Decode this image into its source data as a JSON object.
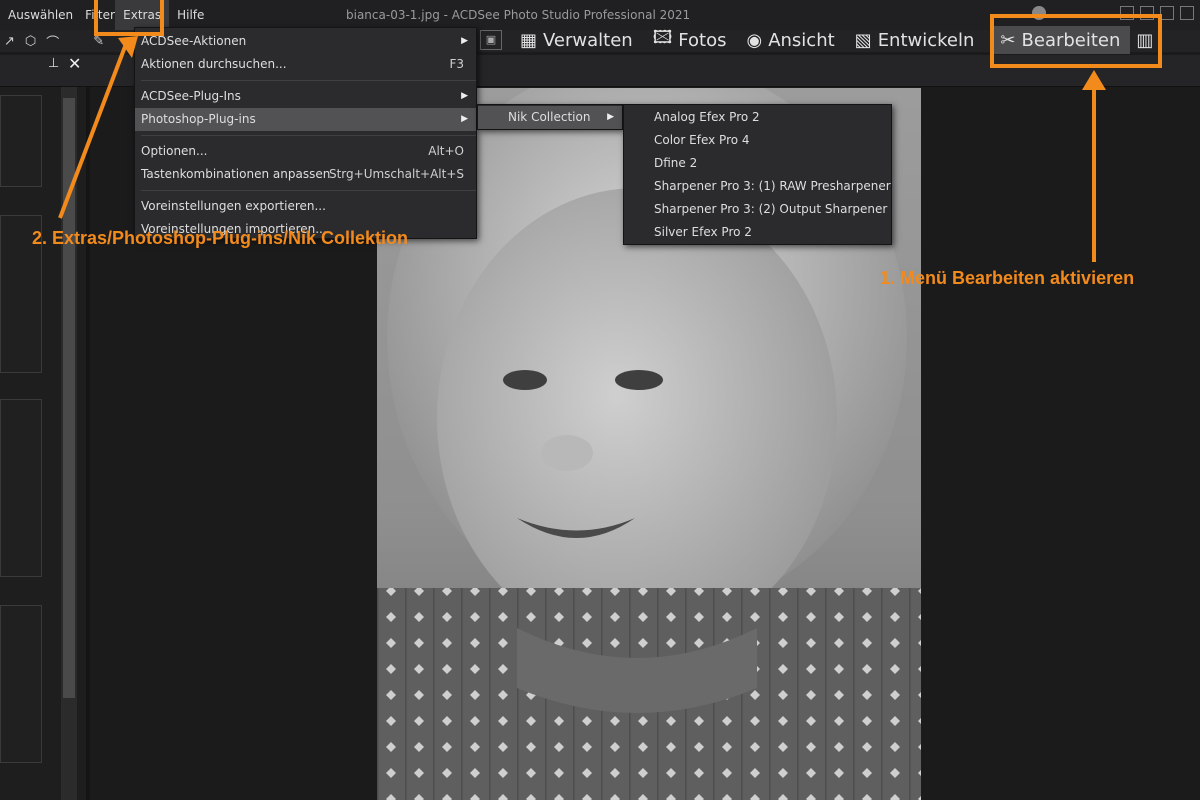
{
  "window": {
    "title": "bianca-03-1.jpg - ACDSee Photo Studio Professional 2021"
  },
  "menubar": [
    {
      "label": "Auswählen"
    },
    {
      "label": "Filter"
    },
    {
      "label": "Extras"
    },
    {
      "label": "Hilfe"
    }
  ],
  "modes": [
    {
      "label": "Verwalten",
      "icon": "grid-icon"
    },
    {
      "label": "Fotos",
      "icon": "photos-icon"
    },
    {
      "label": "Ansicht",
      "icon": "eye-icon"
    },
    {
      "label": "Entwickeln",
      "icon": "develop-icon"
    },
    {
      "label": "Bearbeiten",
      "icon": "edit-tools-icon"
    }
  ],
  "extras_menu": [
    {
      "label": "ACDSee-Aktionen",
      "shortcut": "",
      "submenu": true
    },
    {
      "label": "Aktionen durchsuchen...",
      "shortcut": "F3",
      "submenu": false
    },
    {
      "label": "ACDSee-Plug-Ins",
      "shortcut": "",
      "submenu": true
    },
    {
      "label": "Photoshop-Plug-ins",
      "shortcut": "",
      "submenu": true
    },
    {
      "label": "Optionen...",
      "shortcut": "Alt+O",
      "submenu": false
    },
    {
      "label": "Tastenkombinationen anpassen",
      "shortcut": "Strg+Umschalt+Alt+S",
      "submenu": false
    },
    {
      "label": "Voreinstellungen exportieren...",
      "shortcut": "",
      "submenu": false
    },
    {
      "label": "Voreinstellungen importieren...",
      "shortcut": "",
      "submenu": false
    }
  ],
  "photoshop_submenu": [
    {
      "label": "Nik Collection",
      "submenu": true
    }
  ],
  "nik_submenu": [
    {
      "label": "Analog Efex Pro 2"
    },
    {
      "label": "Color Efex Pro 4"
    },
    {
      "label": "Dfine 2"
    },
    {
      "label": "Sharpener Pro 3: (1) RAW Presharpener"
    },
    {
      "label": "Sharpener Pro 3: (2) Output Sharpener"
    },
    {
      "label": "Silver Efex Pro 2"
    }
  ],
  "annotations": {
    "step1": "1. Menü Bearbeiten aktivieren",
    "step2": "2. Extras/Photoshop-Plug-ins/Nik Collektion",
    "color": "#f28a1c"
  }
}
